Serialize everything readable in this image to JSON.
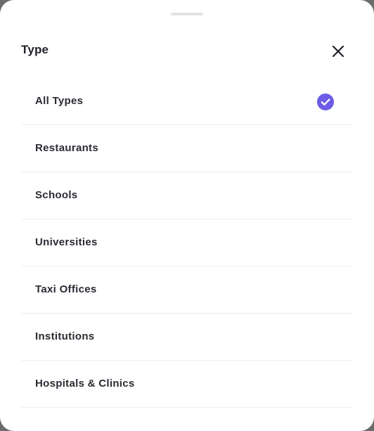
{
  "sheet": {
    "title": "Type",
    "close_icon": "close-icon",
    "accent_color": "#6c5ce7"
  },
  "options": [
    {
      "label": "All Types",
      "selected": true
    },
    {
      "label": "Restaurants",
      "selected": false
    },
    {
      "label": "Schools",
      "selected": false
    },
    {
      "label": "Universities",
      "selected": false
    },
    {
      "label": "Taxi Offices",
      "selected": false
    },
    {
      "label": "Institutions",
      "selected": false
    },
    {
      "label": "Hospitals & Clinics",
      "selected": false
    }
  ]
}
